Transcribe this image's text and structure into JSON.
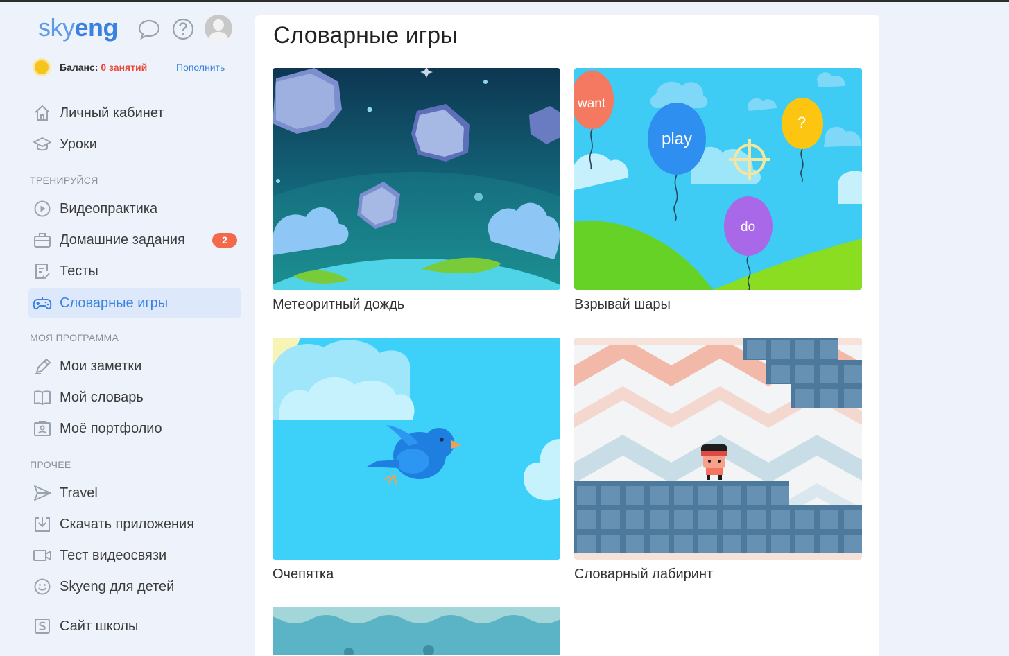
{
  "header": {
    "logo_sky": "sky",
    "logo_eng": "eng",
    "balance_label": "Баланс: ",
    "balance_value": "0 занятий",
    "topup_label": "Пополнить"
  },
  "sidebar": {
    "primary": [
      {
        "label": "Личный кабинет",
        "icon": "home-icon"
      },
      {
        "label": "Уроки",
        "icon": "graduation-cap-icon"
      }
    ],
    "section_train": "ТРЕНИРУЙСЯ",
    "train": [
      {
        "label": "Видеопрактика",
        "icon": "play-circle-icon"
      },
      {
        "label": "Домашние задания",
        "icon": "briefcase-icon",
        "badge": "2"
      },
      {
        "label": "Тесты",
        "icon": "test-icon"
      },
      {
        "label": "Словарные игры",
        "icon": "gamepad-icon",
        "active": true
      }
    ],
    "section_program": "МОЯ ПРОГРАММА",
    "program": [
      {
        "label": "Мои заметки",
        "icon": "pencil-icon"
      },
      {
        "label": "Мой словарь",
        "icon": "book-icon"
      },
      {
        "label": "Моё портфолио",
        "icon": "portfolio-icon"
      }
    ],
    "section_other": "ПРОЧЕЕ",
    "other": [
      {
        "label": "Travel",
        "icon": "send-icon"
      },
      {
        "label": "Скачать приложения",
        "icon": "download-icon"
      },
      {
        "label": "Тест видеосвязи",
        "icon": "video-camera-icon"
      },
      {
        "label": "Skyeng для детей",
        "icon": "smile-icon"
      },
      {
        "label": "Сайт школы",
        "icon": "s-square-icon"
      }
    ]
  },
  "main": {
    "title": "Словарные игры",
    "games": [
      {
        "title": "Метеоритный дождь"
      },
      {
        "title": "Взрывай шары",
        "balloon_words": [
          "want",
          "play",
          "?",
          "do"
        ]
      },
      {
        "title": "Очепятка"
      },
      {
        "title": "Словарный лабиринт"
      }
    ]
  },
  "colors": {
    "accent": "#3b82e0",
    "badge": "#f26a4a",
    "balance_value": "#e84a3a",
    "active_bg": "#dde9fb"
  }
}
